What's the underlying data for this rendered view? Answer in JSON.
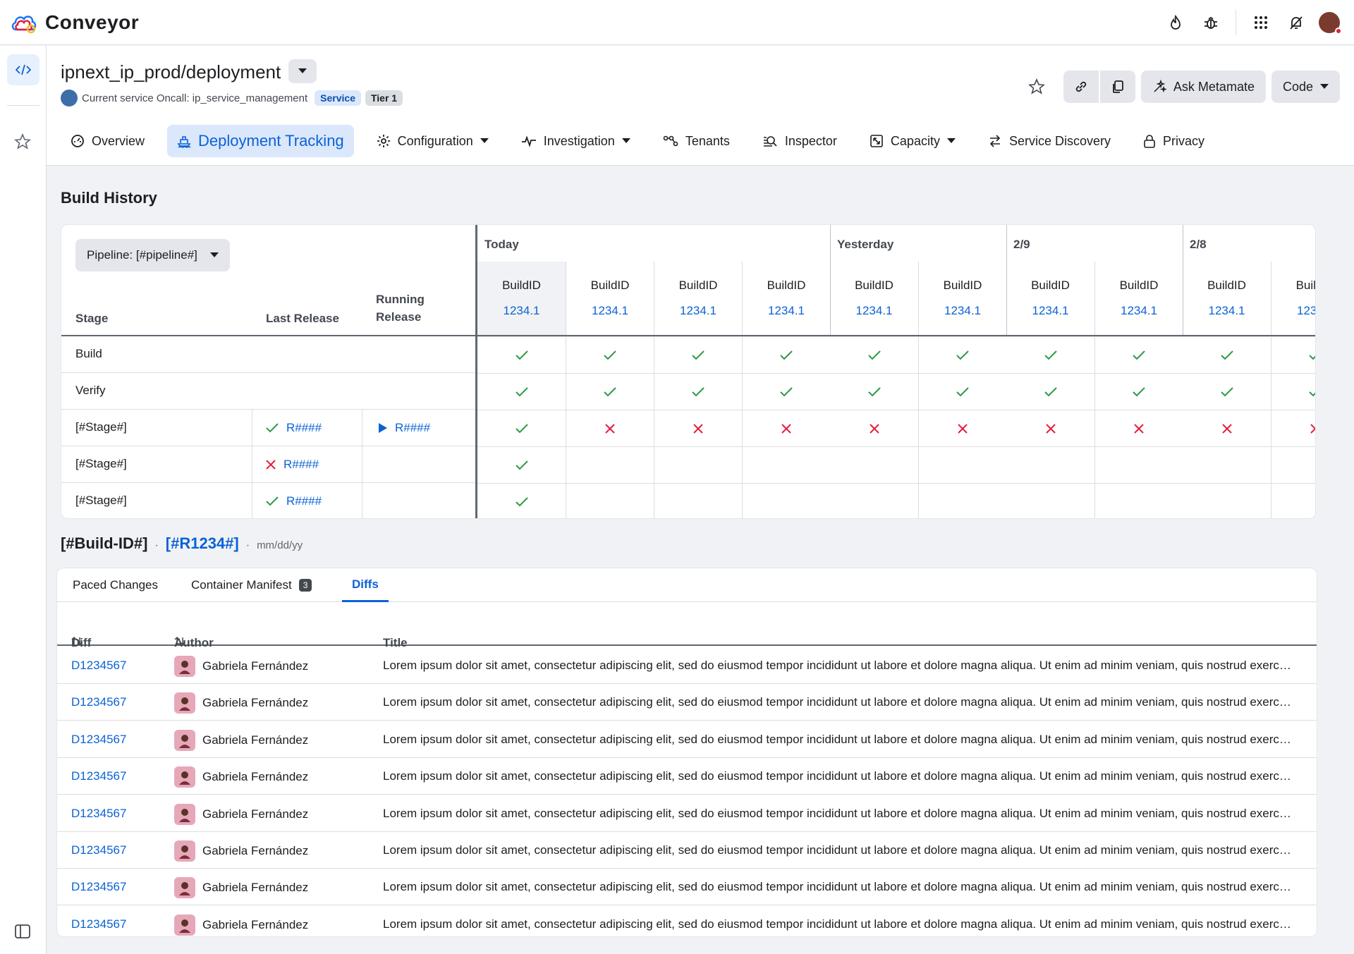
{
  "app": {
    "name": "Conveyor"
  },
  "service": {
    "title": "ipnext_ip_prod/deployment",
    "oncall_label": "Current service Oncall: ip_service_management",
    "badge_service": "Service",
    "badge_tier": "Tier 1"
  },
  "actions": {
    "ask_label": "Ask Metamate",
    "code_label": "Code"
  },
  "nav": {
    "overview": "Overview",
    "deployment": "Deployment Tracking",
    "configuration": "Configuration",
    "investigation": "Investigation",
    "tenants": "Tenants",
    "inspector": "Inspector",
    "capacity": "Capacity",
    "discovery": "Service Discovery",
    "privacy": "Privacy"
  },
  "build_history": {
    "title": "Build History",
    "pipeline_label": "Pipeline: [#pipeline#]",
    "col_stage": "Stage",
    "col_last": "Last Release",
    "col_running_1": "Running",
    "col_running_2": "Release",
    "days": [
      "Today",
      "Yesterday",
      "2/9",
      "2/8"
    ],
    "build_label": "BuildID",
    "build_number": "1234.1",
    "stages": [
      {
        "name": "Build",
        "last": "",
        "last_status": "",
        "running": ""
      },
      {
        "name": "Verify",
        "last": "",
        "last_status": "",
        "running": ""
      },
      {
        "name": "[#Stage#]",
        "last": "R####",
        "last_status": "pass",
        "running": "R####"
      },
      {
        "name": "[#Stage#]",
        "last": "R####",
        "last_status": "fail",
        "running": ""
      },
      {
        "name": "[#Stage#]",
        "last": "R####",
        "last_status": "pass",
        "running": ""
      }
    ],
    "statuses": [
      [
        "pass",
        "pass",
        "pass",
        "pass",
        "pass",
        "pass",
        "pass",
        "pass",
        "pass",
        "pass"
      ],
      [
        "pass",
        "pass",
        "pass",
        "pass",
        "pass",
        "pass",
        "pass",
        "pass",
        "pass",
        "pass"
      ],
      [
        "pass",
        "fail",
        "fail",
        "fail",
        "fail",
        "fail",
        "fail",
        "fail",
        "fail",
        "fail"
      ],
      [
        "pass",
        "",
        "",
        "",
        "",
        "",
        "",
        "",
        "",
        ""
      ],
      [
        "pass",
        "",
        "",
        "",
        "",
        "",
        "",
        "",
        "",
        ""
      ]
    ]
  },
  "build_detail": {
    "id": "[#Build-ID#]",
    "release": "[#R1234#]",
    "date": "mm/dd/yy"
  },
  "tabs": {
    "paced": "Paced Changes",
    "manifest": "Container Manifest",
    "manifest_count": "3",
    "diffs": "Diffs"
  },
  "diffs": {
    "col_diff": "Diff",
    "col_author": "Author",
    "col_title": "Title",
    "rows": [
      {
        "diff": "D1234567",
        "author": "Gabriela Fernández",
        "title": "Lorem ipsum dolor sit amet, consectetur adipiscing elit, sed do eiusmod tempor incididunt ut labore et dolore magna aliqua. Ut enim ad minim veniam, quis nostrud exercitation"
      },
      {
        "diff": "D1234567",
        "author": "Gabriela Fernández",
        "title": "Lorem ipsum dolor sit amet, consectetur adipiscing elit, sed do eiusmod tempor incididunt ut labore et dolore magna aliqua. Ut enim ad minim veniam, quis nostrud exercitation"
      },
      {
        "diff": "D1234567",
        "author": "Gabriela Fernández",
        "title": "Lorem ipsum dolor sit amet, consectetur adipiscing elit, sed do eiusmod tempor incididunt ut labore et dolore magna aliqua. Ut enim ad minim veniam, quis nostrud exercitation"
      },
      {
        "diff": "D1234567",
        "author": "Gabriela Fernández",
        "title": "Lorem ipsum dolor sit amet, consectetur adipiscing elit, sed do eiusmod tempor incididunt ut labore et dolore magna aliqua. Ut enim ad minim veniam, quis nostrud exercitation"
      },
      {
        "diff": "D1234567",
        "author": "Gabriela Fernández",
        "title": "Lorem ipsum dolor sit amet, consectetur adipiscing elit, sed do eiusmod tempor incididunt ut labore et dolore magna aliqua. Ut enim ad minim veniam, quis nostrud exercitation"
      },
      {
        "diff": "D1234567",
        "author": "Gabriela Fernández",
        "title": "Lorem ipsum dolor sit amet, consectetur adipiscing elit, sed do eiusmod tempor incididunt ut labore et dolore magna aliqua. Ut enim ad minim veniam, quis nostrud exercitation"
      },
      {
        "diff": "D1234567",
        "author": "Gabriela Fernández",
        "title": "Lorem ipsum dolor sit amet, consectetur adipiscing elit, sed do eiusmod tempor incididunt ut labore et dolore magna aliqua. Ut enim ad minim veniam, quis nostrud exercitation"
      },
      {
        "diff": "D1234567",
        "author": "Gabriela Fernández",
        "title": "Lorem ipsum dolor sit amet, consectetur adipiscing elit, sed do eiusmod tempor incididunt ut labore et dolore magna aliqua. Ut enim ad minim veniam, quis nostrud exercitation"
      }
    ]
  },
  "colors": {
    "accent": "#0b62d6",
    "pass": "#2e9a47",
    "fail": "#e41e3f"
  }
}
